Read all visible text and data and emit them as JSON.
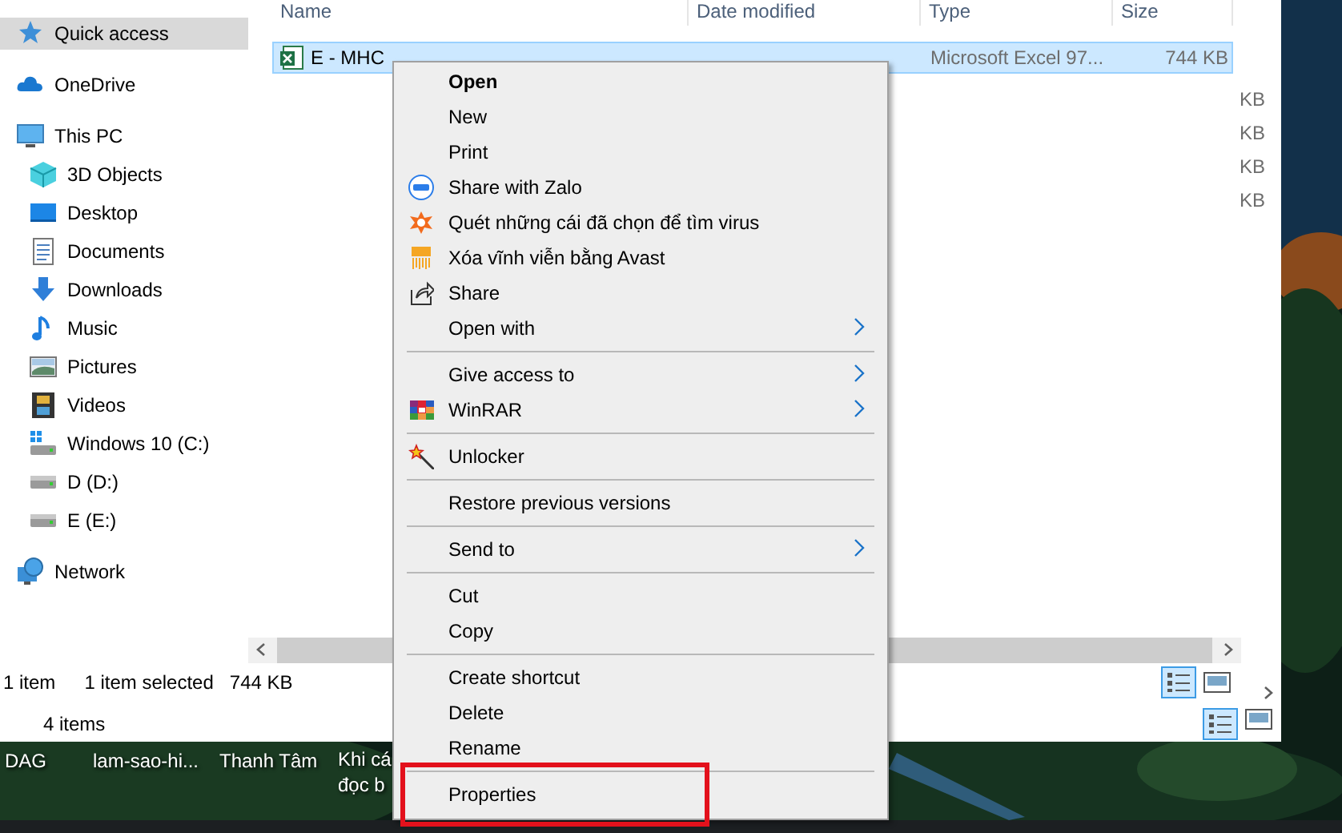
{
  "back_window": {
    "size_column": [
      "KB",
      "KB",
      "KB",
      "KB"
    ],
    "status_bar": {
      "item_count": "4 items"
    }
  },
  "explorer": {
    "sidebar": [
      {
        "label": "Quick access",
        "selected": true
      },
      {
        "label": "OneDrive",
        "selected": false
      },
      {
        "label": "This PC",
        "selected": false,
        "children": [
          {
            "label": "3D Objects",
            "selected": false
          },
          {
            "label": "Desktop",
            "selected": false
          },
          {
            "label": "Documents",
            "selected": false
          },
          {
            "label": "Downloads",
            "selected": false
          },
          {
            "label": "Music",
            "selected": false
          },
          {
            "label": "Pictures",
            "selected": false
          },
          {
            "label": "Videos",
            "selected": false
          },
          {
            "label": "Windows 10 (C:)",
            "selected": false
          },
          {
            "label": "D (D:)",
            "selected": false
          },
          {
            "label": "E (E:)",
            "selected": false
          }
        ]
      },
      {
        "label": "Network",
        "selected": false
      }
    ],
    "columns": [
      "Name",
      "Date modified",
      "Type",
      "Size"
    ],
    "files": [
      {
        "name": "E - MHC",
        "type": "Microsoft Excel 97...",
        "size": "744 KB",
        "selected": true
      }
    ],
    "status_bar": {
      "item_count": "1 item",
      "selection": "1 item selected",
      "selection_size": "744 KB"
    }
  },
  "context_menu": [
    {
      "kind": "item",
      "label": "Open",
      "default": true,
      "submenu": false,
      "highlighted": false
    },
    {
      "kind": "item",
      "label": "New",
      "default": false,
      "submenu": false,
      "highlighted": false
    },
    {
      "kind": "item",
      "label": "Print",
      "default": false,
      "submenu": false,
      "highlighted": false
    },
    {
      "kind": "item",
      "label": "Share with Zalo",
      "default": false,
      "submenu": false,
      "highlighted": false
    },
    {
      "kind": "item",
      "label": "Quét những cái đã chọn để tìm virus",
      "default": false,
      "submenu": false,
      "highlighted": false
    },
    {
      "kind": "item",
      "label": "Xóa vĩnh viễn bằng Avast",
      "default": false,
      "submenu": false,
      "highlighted": false
    },
    {
      "kind": "item",
      "label": "Share",
      "default": false,
      "submenu": false,
      "highlighted": false
    },
    {
      "kind": "item",
      "label": "Open with",
      "default": false,
      "submenu": true,
      "highlighted": false
    },
    {
      "kind": "separator"
    },
    {
      "kind": "item",
      "label": "Give access to",
      "default": false,
      "submenu": true,
      "highlighted": false
    },
    {
      "kind": "item",
      "label": "WinRAR",
      "default": false,
      "submenu": true,
      "highlighted": false
    },
    {
      "kind": "separator"
    },
    {
      "kind": "item",
      "label": "Unlocker",
      "default": false,
      "submenu": false,
      "highlighted": false
    },
    {
      "kind": "separator"
    },
    {
      "kind": "item",
      "label": "Restore previous versions",
      "default": false,
      "submenu": false,
      "highlighted": false
    },
    {
      "kind": "separator"
    },
    {
      "kind": "item",
      "label": "Send to",
      "default": false,
      "submenu": true,
      "highlighted": false
    },
    {
      "kind": "separator"
    },
    {
      "kind": "item",
      "label": "Cut",
      "default": false,
      "submenu": false,
      "highlighted": false
    },
    {
      "kind": "item",
      "label": "Copy",
      "default": false,
      "submenu": false,
      "highlighted": false
    },
    {
      "kind": "separator"
    },
    {
      "kind": "item",
      "label": "Create shortcut",
      "default": false,
      "submenu": false,
      "highlighted": false
    },
    {
      "kind": "item",
      "label": "Delete",
      "default": false,
      "submenu": false,
      "highlighted": false
    },
    {
      "kind": "item",
      "label": "Rename",
      "default": false,
      "submenu": false,
      "highlighted": false
    },
    {
      "kind": "separator"
    },
    {
      "kind": "item",
      "label": "Properties",
      "default": false,
      "submenu": false,
      "highlighted": true
    }
  ],
  "desktop_icons": [
    {
      "label": "DAG"
    },
    {
      "label": "lam-sao-hi..."
    },
    {
      "label": "Thanh Tâm"
    },
    {
      "label": "Khi cá\nđọc b"
    }
  ]
}
